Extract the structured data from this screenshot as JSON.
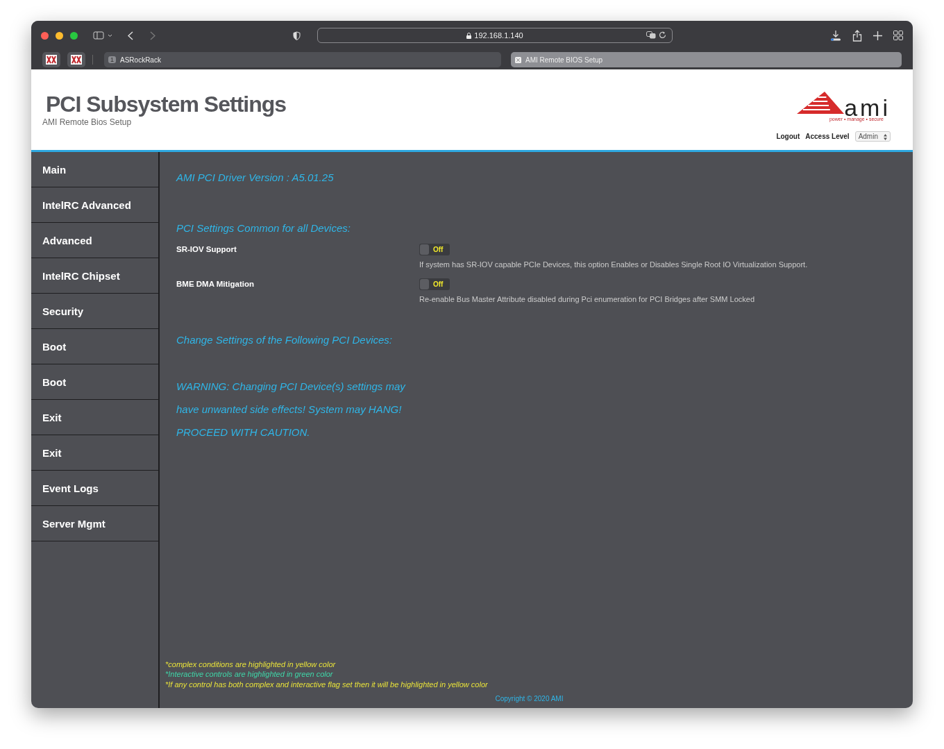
{
  "browser": {
    "url": "192.168.1.140",
    "tabs": [
      {
        "label": "ASRockRack",
        "badge": "1",
        "selected": false
      },
      {
        "label": "AMI Remote BIOS Setup",
        "selected": true
      }
    ]
  },
  "header": {
    "title": "PCI Subsystem Settings",
    "subtitle": "AMI Remote Bios Setup",
    "logo": {
      "wordmark": "ami",
      "tagline": "power • manage • secure"
    },
    "logout": "Logout",
    "access_label": "Access Level",
    "access_value": "Admin"
  },
  "sidebar": {
    "items": [
      "Main",
      "IntelRC Advanced",
      "Advanced",
      "IntelRC Chipset",
      "Security",
      "Boot",
      "Boot",
      "Exit",
      "Exit",
      "Event Logs",
      "Server Mgmt"
    ]
  },
  "content": {
    "driver_version": "AMI PCI Driver Version : A5.01.25",
    "common_heading": "PCI Settings Common for all Devices:",
    "settings": [
      {
        "label": "SR-IOV Support",
        "toggle": {
          "on": false,
          "text": "Off"
        },
        "description": "If system has SR-IOV capable PCIe Devices, this option Enables or Disables Single Root IO Virtualization Support."
      },
      {
        "label": "BME DMA Mitigation",
        "toggle": {
          "on": false,
          "text": "Off"
        },
        "description": "Re-enable Bus Master Attribute disabled during Pci enumeration for PCI Bridges after SMM Locked"
      }
    ],
    "devices_heading": "Change Settings of the Following PCI Devices:",
    "warning": [
      "WARNING: Changing PCI Device(s) settings may",
      "have unwanted side effects! System may HANG!",
      "PROCEED WITH CAUTION."
    ]
  },
  "footnotes": [
    {
      "text": "*complex conditions are highlighted in yellow color",
      "color": "#e8e23a"
    },
    {
      "text": "*Interactive controls are highlighted in green color",
      "color": "#3fd6a8"
    },
    {
      "text": "*If any control has both complex and interactive flag set then it will be highlighted in yellow color",
      "color": "#e8e23a"
    }
  ],
  "copyright": "Copyright © 2020 AMI"
}
